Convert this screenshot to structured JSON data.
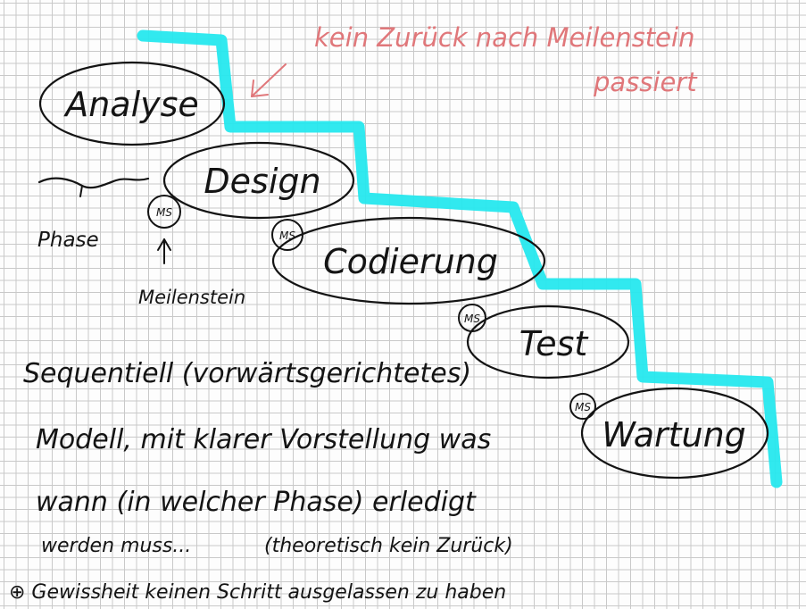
{
  "diagram": {
    "phases": [
      {
        "id": "analyse",
        "label": "Analyse"
      },
      {
        "id": "design",
        "label": "Design"
      },
      {
        "id": "codierung",
        "label": "Codierung"
      },
      {
        "id": "test",
        "label": "Test"
      },
      {
        "id": "wartung",
        "label": "Wartung"
      }
    ],
    "milestone_label": "MS",
    "annotation": {
      "line1": "kein Zurück nach Meilenstein",
      "line2": "passiert"
    },
    "legend": {
      "phase": "Phase",
      "milestone": "Meilenstein"
    },
    "notes": [
      "Sequentiell (vorwärtsgerichtetes)",
      "Modell, mit klarer Vorstellung was",
      "wann (in welcher Phase) erledigt",
      "werden muss...",
      "(theoretisch kein Zurück)",
      "⊕ Gewissheit keinen Schritt ausgelassen zu haben"
    ],
    "colors": {
      "ink": "#141414",
      "highlight": "#26e8ee",
      "annotation": "#e0777a",
      "grid": "#c9c9c9"
    }
  }
}
